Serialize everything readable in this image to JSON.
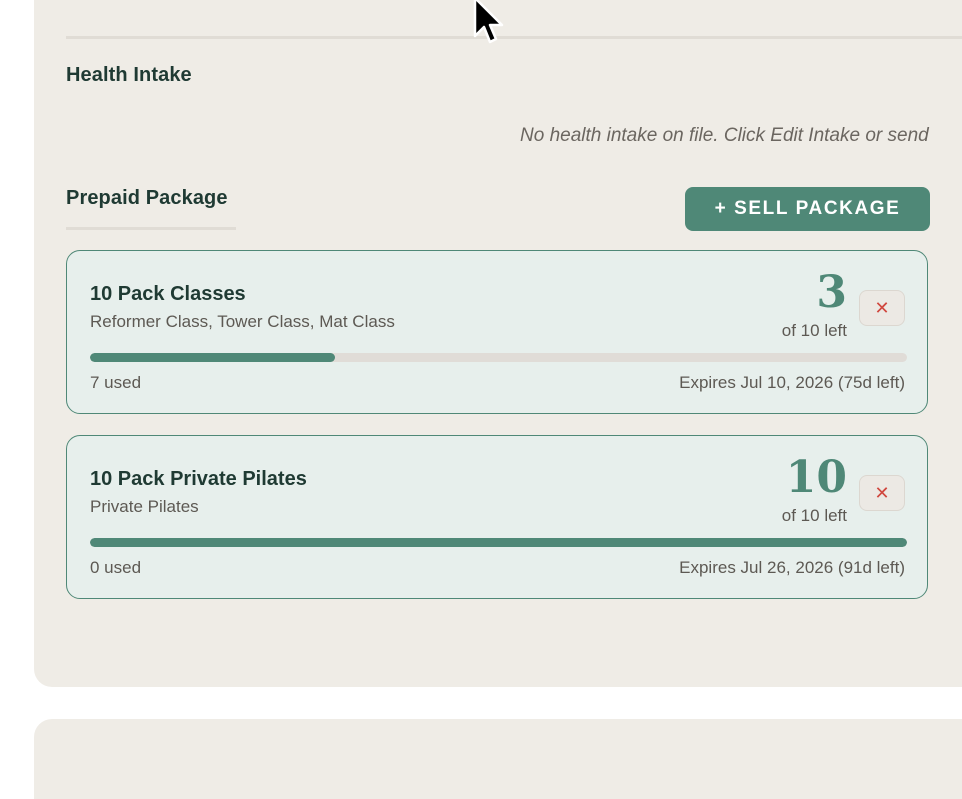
{
  "health_intake": {
    "title": "Health Intake",
    "empty_message": "No health intake on file. Click Edit Intake or send"
  },
  "prepaid_package": {
    "title": "Prepaid Package",
    "sell_button_label": "+ SELL PACKAGE",
    "packages": [
      {
        "name": "10 Pack Classes",
        "classes": "Reformer Class, Tower Class, Mat Class",
        "remaining": "3",
        "remaining_label": "of 10 left",
        "used_label": "7 used",
        "expires_label": "Expires Jul 10, 2026 (75d left)",
        "used_fraction": 0.3,
        "remove_icon": "close-icon"
      },
      {
        "name": "10 Pack Private Pilates",
        "classes": "Private Pilates",
        "remaining": "10",
        "remaining_label": "of 10 left",
        "used_label": "0 used",
        "expires_label": "Expires Jul 26, 2026 (91d left)",
        "used_fraction": 1.0,
        "remove_icon": "close-icon"
      }
    ]
  },
  "colors": {
    "panel_bg": "#efece6",
    "accent": "#4f8877",
    "card_bg": "#e7efec",
    "danger": "#d0473e"
  }
}
